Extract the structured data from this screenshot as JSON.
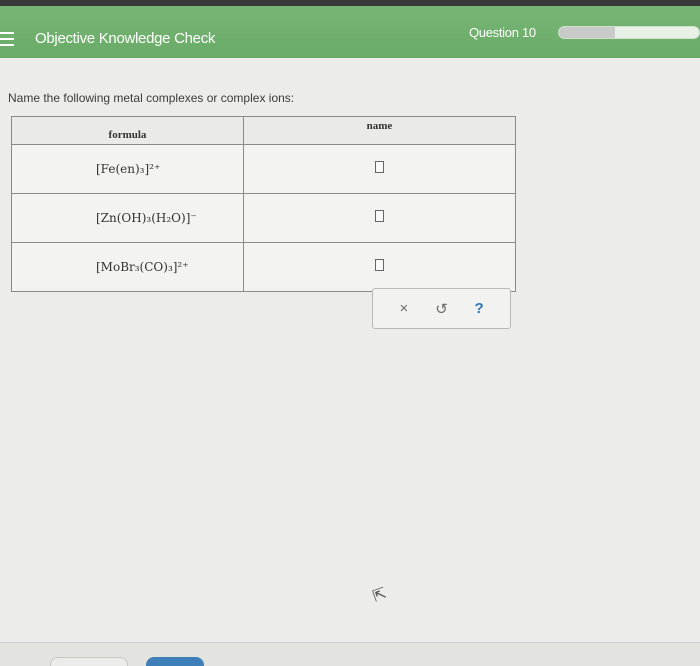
{
  "header": {
    "title": "Objective Knowledge Check",
    "question_label": "Question 10",
    "progress_fraction": 0.4
  },
  "question": {
    "prompt": "Name the following metal complexes or complex ions:"
  },
  "table": {
    "headers": [
      "formula",
      "name"
    ],
    "rows": [
      {
        "formula": "[Fe(en)₃]²⁺",
        "name_value": ""
      },
      {
        "formula": "[Zn(OH)₃(H₂O)]⁻",
        "name_value": ""
      },
      {
        "formula": "[MoBr₃(CO)₃]²⁺",
        "name_value": ""
      }
    ]
  },
  "toolbar": {
    "clear": "×",
    "undo": "↺",
    "help": "?"
  },
  "colors": {
    "header_green": "#6aab68",
    "help_blue": "#2a77b8",
    "primary_button_blue": "#3f7fb9"
  }
}
